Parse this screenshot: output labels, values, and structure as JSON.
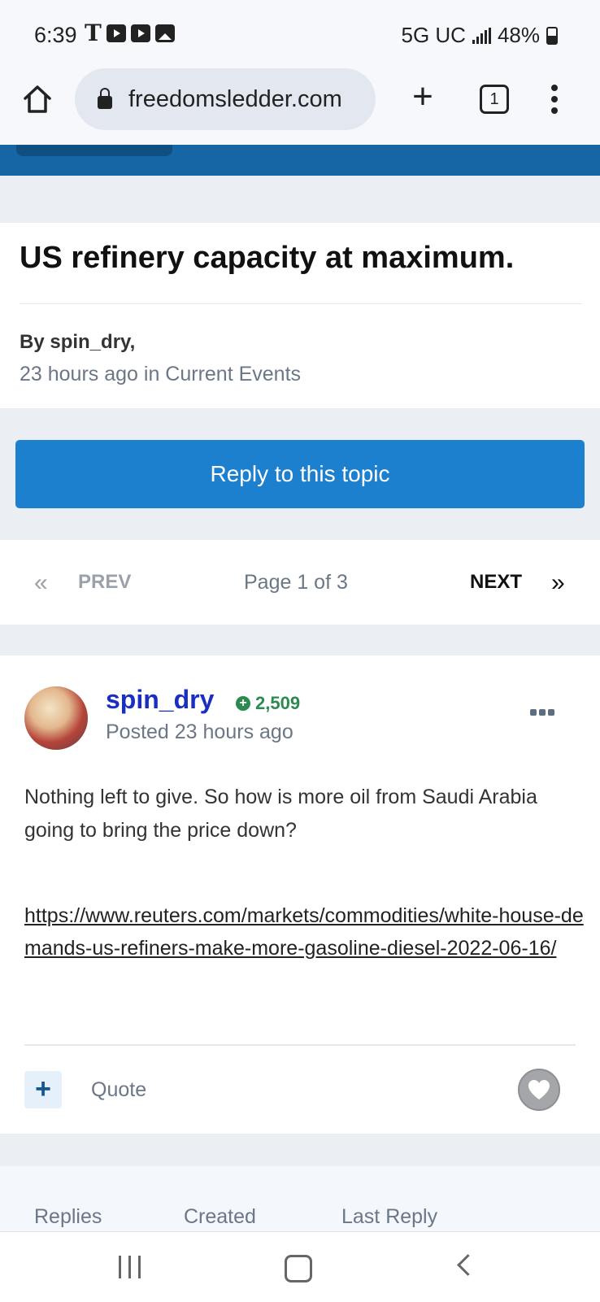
{
  "status_bar": {
    "time": "6:39",
    "carrier_icon": "T",
    "network": "5G UC",
    "battery": "48%"
  },
  "browser": {
    "url": "freedomsledder.com",
    "tab_count": "1"
  },
  "topic": {
    "title": "US refinery capacity at maximum.",
    "byline": "By spin_dry,",
    "meta": "23 hours ago in Current Events"
  },
  "reply_button": "Reply to this topic",
  "pagination": {
    "prev_chevron": "«",
    "prev": "PREV",
    "page_info": "Page 1 of 3",
    "next": "NEXT",
    "next_chevron": "»"
  },
  "post": {
    "author": "spin_dry",
    "reputation": "2,509",
    "posted": "Posted 23 hours ago",
    "body": "Nothing left to give. So how is more oil from Saudi Arabia going to bring the price down?",
    "link": "https://www.reuters.com/markets/commodities/white-house-demands-us-refiners-make-more-gasoline-diesel-2022-06-16/",
    "add_label": "+",
    "quote": "Quote"
  },
  "stats": {
    "replies": "Replies",
    "created": "Created",
    "last_reply": "Last Reply"
  },
  "colors": {
    "brand_blue": "#1666a6",
    "button_blue": "#1d80cf",
    "author_link": "#1a2fc2",
    "reputation_green": "#2c8a4f"
  }
}
